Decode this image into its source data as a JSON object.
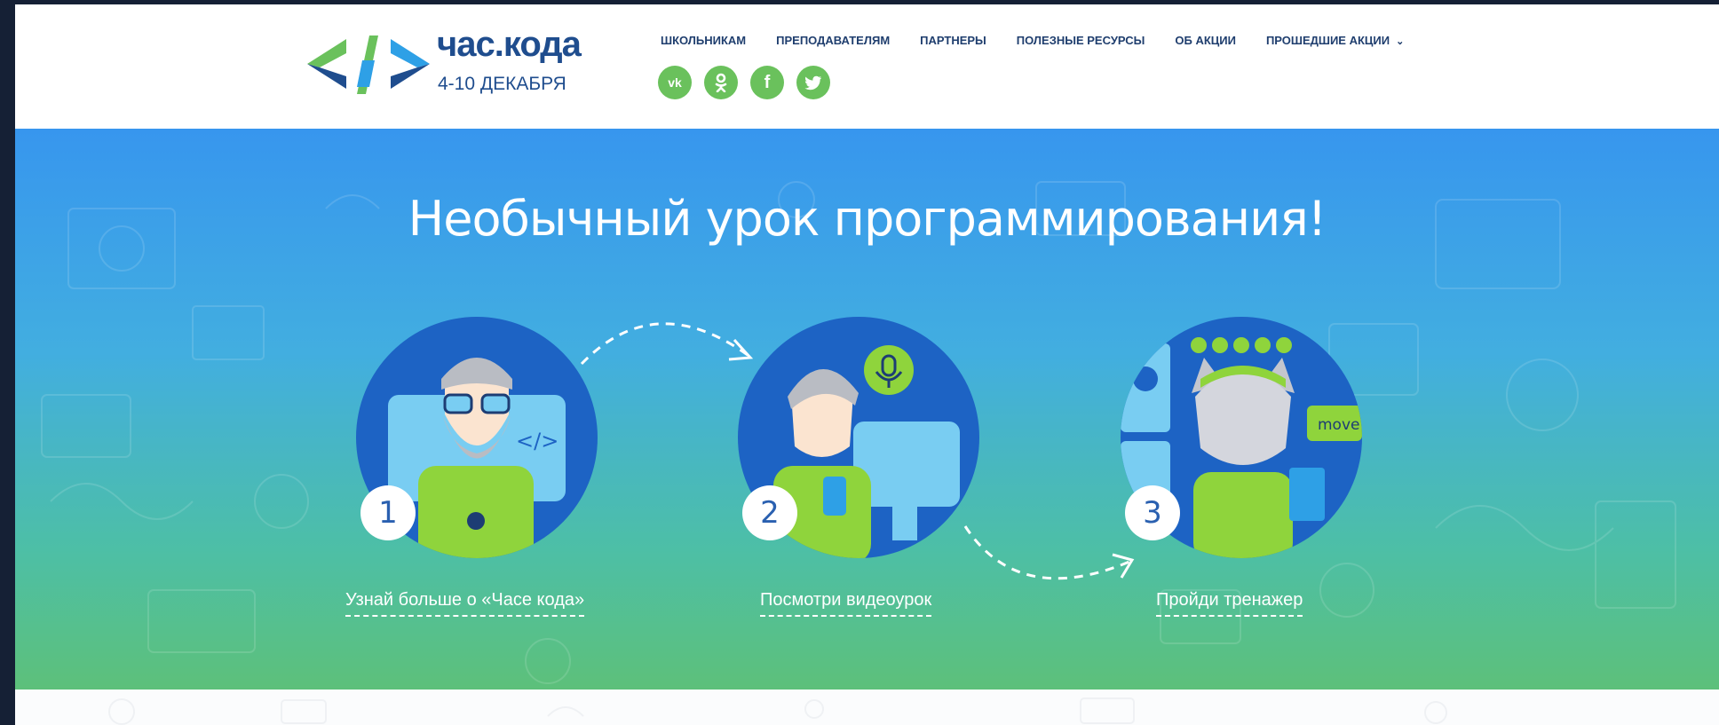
{
  "logo": {
    "title": "час.кода",
    "subtitle": "4-10 ДЕКАБРЯ"
  },
  "nav": {
    "items": [
      "ШКОЛЬНИКАМ",
      "ПРЕПОДАВАТЕЛЯМ",
      "ПАРТНЕРЫ",
      "ПОЛЕЗНЫЕ РЕСУРСЫ",
      "ОБ АКЦИИ",
      "ПРОШЕДШИЕ АКЦИИ"
    ],
    "dropdown_icon": "chevron-down-icon"
  },
  "social": {
    "icons": [
      "vk-icon",
      "odnoklassniki-icon",
      "facebook-icon",
      "twitter-icon"
    ],
    "color": "#6ac15c"
  },
  "hero": {
    "title": "Необычный урок программирования!",
    "steps": [
      {
        "number": "1",
        "label": "Узнай больше о «Часе кода»"
      },
      {
        "number": "2",
        "label": "Посмотри видеоурок"
      },
      {
        "number": "3",
        "label": "Пройди тренажер"
      }
    ],
    "code_tag": "</>",
    "move_label": "move"
  },
  "colors": {
    "brand_blue": "#1f4d8e",
    "accent_green": "#6ac15c",
    "circle_blue": "#1d63c4",
    "gradient_top": "#3796ee",
    "gradient_bottom": "#5dc07a"
  }
}
